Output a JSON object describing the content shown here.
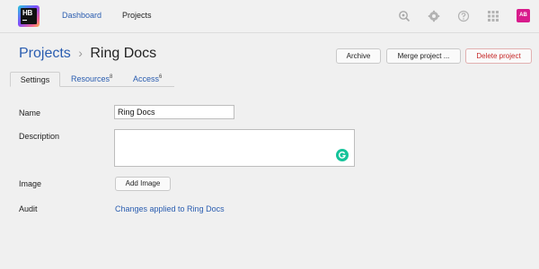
{
  "header": {
    "logo_text": "HB",
    "nav": {
      "dashboard": "Dashboard",
      "projects": "Projects"
    },
    "icons": [
      "search-icon",
      "gear-icon",
      "help-icon",
      "apps-grid-icon"
    ],
    "avatar_initials": "AB"
  },
  "breadcrumb": {
    "parent": "Projects",
    "separator": "›",
    "current": "Ring Docs"
  },
  "actions": {
    "archive": "Archive",
    "merge": "Merge project ...",
    "delete": "Delete project"
  },
  "tabs": [
    {
      "label": "Settings",
      "count": ""
    },
    {
      "label": "Resources",
      "count": "8"
    },
    {
      "label": "Access",
      "count": "6"
    }
  ],
  "form": {
    "name_label": "Name",
    "name_value": "Ring Docs",
    "description_label": "Description",
    "description_value": "",
    "image_label": "Image",
    "add_image": "Add Image",
    "audit_label": "Audit",
    "audit_link": "Changes applied to Ring Docs"
  },
  "colors": {
    "link": "#2a5db0",
    "delete": "#c62828",
    "avatar": "#d81b8c",
    "grammarly": "#15c39a"
  }
}
